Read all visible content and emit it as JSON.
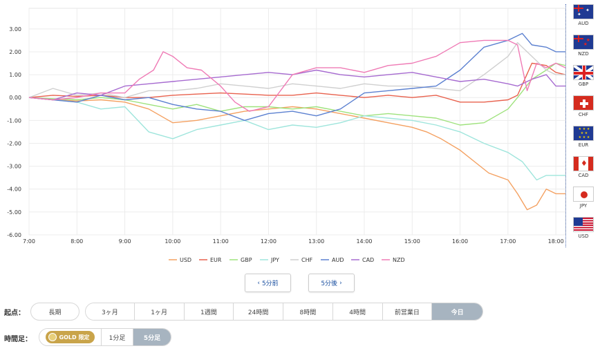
{
  "chart_data": {
    "type": "line",
    "x_ticks": [
      "7:00",
      "8:00",
      "9:00",
      "10:00",
      "11:00",
      "12:00",
      "13:00",
      "14:00",
      "15:00",
      "16:00",
      "17:00",
      "18:00"
    ],
    "y_ticks": [
      "3.00",
      "2.00",
      "1.00",
      "0.00",
      "-1.00",
      "-2.00",
      "-3.00",
      "-4.00",
      "-5.00",
      "-6.00"
    ],
    "ylim": [
      -6,
      3.9
    ],
    "xlim": [
      7.0,
      18.2
    ],
    "grid": true,
    "legend_position": "bottom",
    "series": [
      {
        "name": "USD",
        "color": "#f4a060",
        "x": [
          7.0,
          7.5,
          8.0,
          8.5,
          9.0,
          9.5,
          10.0,
          10.5,
          11.0,
          11.5,
          12.0,
          12.5,
          13.0,
          13.5,
          14.0,
          14.5,
          15.0,
          15.3,
          15.6,
          16.0,
          16.3,
          16.6,
          17.0,
          17.2,
          17.4,
          17.6,
          17.8,
          18.0,
          18.2
        ],
        "y": [
          0.0,
          -0.1,
          -0.15,
          -0.1,
          -0.2,
          -0.5,
          -1.1,
          -1.0,
          -0.8,
          -0.6,
          -0.5,
          -0.4,
          -0.5,
          -0.7,
          -0.9,
          -1.1,
          -1.3,
          -1.5,
          -1.8,
          -2.3,
          -2.8,
          -3.3,
          -3.6,
          -4.2,
          -4.9,
          -4.7,
          -4.0,
          -4.2,
          -4.2
        ]
      },
      {
        "name": "EUR",
        "color": "#e8604c",
        "x": [
          7.0,
          7.5,
          8.0,
          8.5,
          9.0,
          9.5,
          10.0,
          10.5,
          11.0,
          11.5,
          12.0,
          12.5,
          13.0,
          13.5,
          14.0,
          14.5,
          15.0,
          15.5,
          16.0,
          16.5,
          17.0,
          17.2,
          17.5,
          17.8,
          18.0,
          18.2
        ],
        "y": [
          0.0,
          0.1,
          0.05,
          0.1,
          0.0,
          0.0,
          0.1,
          0.15,
          0.2,
          0.15,
          0.1,
          0.1,
          0.2,
          0.1,
          0.0,
          0.1,
          0.0,
          0.1,
          -0.2,
          -0.2,
          -0.1,
          0.1,
          1.5,
          1.4,
          1.1,
          1.0
        ]
      },
      {
        "name": "GBP",
        "color": "#9ee27c",
        "x": [
          7.0,
          7.5,
          8.0,
          8.5,
          9.0,
          9.5,
          10.0,
          10.5,
          11.0,
          11.5,
          12.0,
          12.5,
          13.0,
          13.5,
          14.0,
          14.5,
          15.0,
          15.5,
          16.0,
          16.5,
          17.0,
          17.2,
          17.5,
          17.8,
          18.0,
          18.2
        ],
        "y": [
          0.0,
          -0.05,
          -0.1,
          0.0,
          -0.1,
          -0.3,
          -0.5,
          -0.3,
          -0.6,
          -0.4,
          -0.4,
          -0.5,
          -0.4,
          -0.6,
          -0.8,
          -0.7,
          -0.8,
          -0.9,
          -1.2,
          -1.1,
          -0.5,
          0.0,
          0.8,
          1.2,
          1.5,
          1.4
        ]
      },
      {
        "name": "JPY",
        "color": "#9ee5dc",
        "x": [
          7.0,
          7.5,
          8.0,
          8.5,
          9.0,
          9.5,
          10.0,
          10.5,
          11.0,
          11.5,
          12.0,
          12.5,
          13.0,
          13.5,
          14.0,
          14.5,
          15.0,
          15.5,
          16.0,
          16.5,
          17.0,
          17.3,
          17.6,
          17.8,
          18.0,
          18.2
        ],
        "y": [
          0.0,
          -0.1,
          -0.2,
          -0.5,
          -0.4,
          -1.5,
          -1.8,
          -1.4,
          -1.2,
          -1.0,
          -1.4,
          -1.2,
          -1.3,
          -1.1,
          -0.8,
          -0.9,
          -1.0,
          -1.2,
          -1.5,
          -2.0,
          -2.4,
          -2.8,
          -3.6,
          -3.4,
          -3.4,
          -3.4
        ]
      },
      {
        "name": "CHF",
        "color": "#cfcfcf",
        "x": [
          7.0,
          7.5,
          8.0,
          8.5,
          9.0,
          9.5,
          10.0,
          10.5,
          11.0,
          11.5,
          12.0,
          12.5,
          13.0,
          13.5,
          14.0,
          14.5,
          15.0,
          15.5,
          16.0,
          16.5,
          17.0,
          17.2,
          17.5,
          17.8,
          18.0,
          18.2
        ],
        "y": [
          0.0,
          0.4,
          0.1,
          0.2,
          0.0,
          0.3,
          0.3,
          0.4,
          0.6,
          0.5,
          0.4,
          0.6,
          0.5,
          0.4,
          0.6,
          0.5,
          0.5,
          0.4,
          0.3,
          1.0,
          1.8,
          2.4,
          1.8,
          1.2,
          1.0,
          1.0
        ]
      },
      {
        "name": "AUD",
        "color": "#5b80d0",
        "x": [
          7.0,
          7.5,
          8.0,
          8.5,
          9.0,
          9.5,
          10.0,
          10.5,
          11.0,
          11.5,
          12.0,
          12.5,
          13.0,
          13.5,
          14.0,
          14.5,
          15.0,
          15.5,
          16.0,
          16.5,
          17.0,
          17.3,
          17.5,
          17.8,
          18.0,
          18.2
        ],
        "y": [
          0.0,
          -0.1,
          -0.2,
          0.1,
          -0.1,
          0.0,
          -0.3,
          -0.5,
          -0.6,
          -1.0,
          -0.7,
          -0.6,
          -0.8,
          -0.5,
          0.2,
          0.3,
          0.4,
          0.5,
          1.2,
          2.2,
          2.5,
          2.8,
          2.3,
          2.2,
          2.0,
          2.0
        ]
      },
      {
        "name": "CAD",
        "color": "#a66ad0",
        "x": [
          7.0,
          7.5,
          8.0,
          8.5,
          9.0,
          9.5,
          10.0,
          10.5,
          11.0,
          11.5,
          12.0,
          12.5,
          13.0,
          13.5,
          14.0,
          14.5,
          15.0,
          15.5,
          16.0,
          16.5,
          17.0,
          17.2,
          17.5,
          17.8,
          18.0,
          18.2
        ],
        "y": [
          0.0,
          -0.1,
          0.2,
          0.1,
          0.5,
          0.6,
          0.7,
          0.8,
          0.9,
          1.0,
          1.1,
          1.0,
          1.2,
          1.0,
          0.9,
          1.0,
          1.1,
          0.9,
          0.7,
          0.8,
          0.6,
          0.5,
          0.8,
          1.0,
          0.5,
          0.5
        ]
      },
      {
        "name": "NZD",
        "color": "#ef7ab5",
        "x": [
          7.0,
          7.5,
          8.0,
          8.5,
          9.0,
          9.3,
          9.6,
          9.8,
          10.0,
          10.3,
          10.6,
          11.0,
          11.3,
          11.6,
          12.0,
          12.5,
          13.0,
          13.5,
          14.0,
          14.5,
          15.0,
          15.5,
          16.0,
          16.5,
          17.0,
          17.2,
          17.4,
          17.6,
          17.8,
          18.0,
          18.2
        ],
        "y": [
          0.0,
          -0.1,
          0.0,
          0.2,
          0.2,
          0.8,
          1.2,
          2.0,
          1.8,
          1.3,
          1.2,
          0.5,
          -0.2,
          -0.6,
          -0.4,
          1.0,
          1.3,
          1.3,
          1.1,
          1.4,
          1.5,
          1.8,
          2.4,
          2.5,
          2.5,
          2.3,
          0.3,
          1.5,
          1.3,
          1.5,
          1.3
        ]
      }
    ]
  },
  "flags": [
    {
      "code": "AUD",
      "icon": "australia-flag-icon"
    },
    {
      "code": "NZD",
      "icon": "new-zealand-flag-icon"
    },
    {
      "code": "GBP",
      "icon": "uk-flag-icon"
    },
    {
      "code": "CHF",
      "icon": "swiss-flag-icon"
    },
    {
      "code": "EUR",
      "icon": "eu-flag-icon"
    },
    {
      "code": "CAD",
      "icon": "canada-flag-icon"
    },
    {
      "code": "JPY",
      "icon": "japan-flag-icon"
    },
    {
      "code": "USD",
      "icon": "usa-flag-icon"
    }
  ],
  "nav": {
    "prev": "5分前",
    "next": "5分後",
    "prev_icon": "‹",
    "next_icon": "›"
  },
  "start_point": {
    "label": "起点：",
    "long_term": "長期",
    "options": [
      "3ヶ月",
      "1ヶ月",
      "1週間",
      "24時間",
      "8時間",
      "4時間",
      "前営業日",
      "今日"
    ],
    "selected": "今日"
  },
  "time_frame": {
    "label": "時間足：",
    "gold_text": "GOLD 限定",
    "options": [
      "1分足",
      "5分足"
    ],
    "selected": "5分足"
  }
}
